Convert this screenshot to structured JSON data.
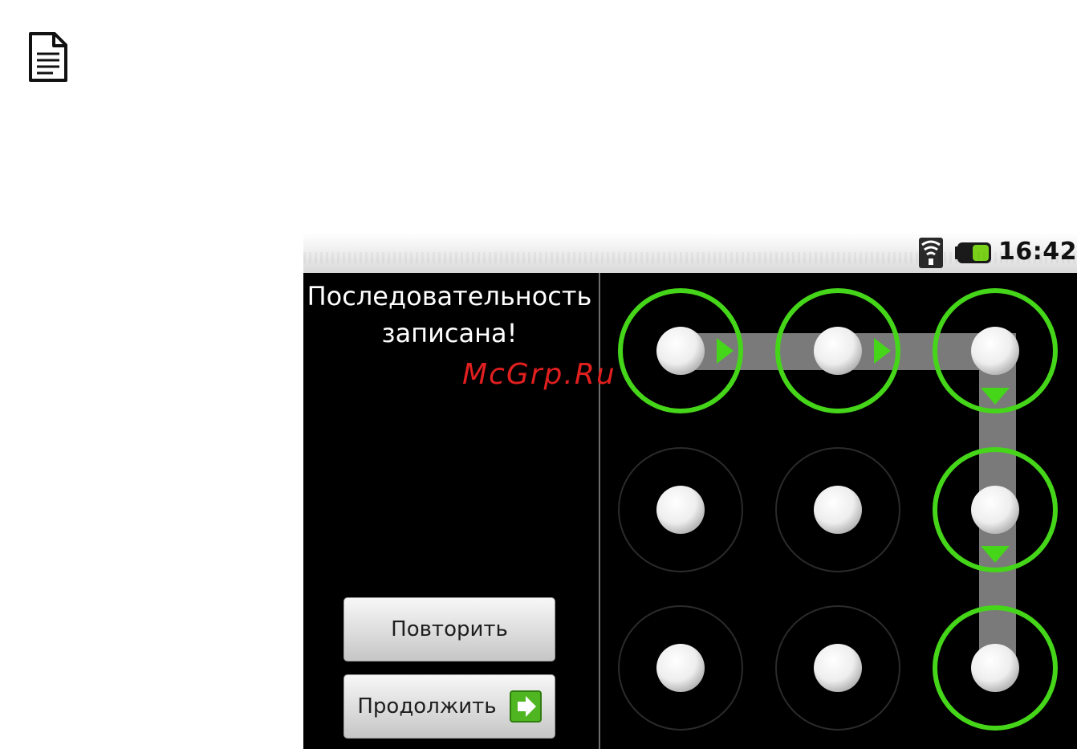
{
  "status_bar": {
    "time": "16:42",
    "wifi_icon": "wifi-icon",
    "battery_icon": "battery-icon"
  },
  "lock_screen": {
    "message_line1": "Последовательность",
    "message_line2": "записана!",
    "retry_label": "Повторить",
    "continue_label": "Продолжить",
    "continue_icon": "arrow-right-icon"
  },
  "watermark": "McGrp.Ru",
  "page_icon": "document-icon",
  "pattern": {
    "grid": "3x3",
    "selected_dots": [
      1,
      2,
      3,
      6,
      9
    ],
    "active_color": "#45d61a",
    "track_color": "#7a7a7a"
  }
}
